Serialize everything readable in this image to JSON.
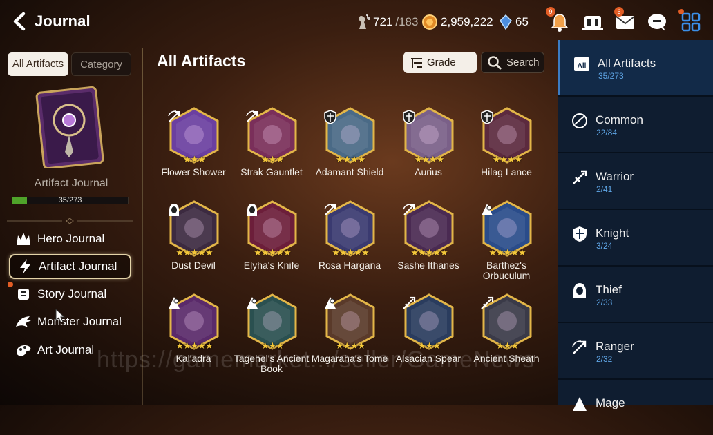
{
  "header": {
    "title": "Journal",
    "stamina": "721",
    "stamina_max": "/183",
    "gold": "2,959,222",
    "crystals": "65",
    "alerts_badge": "9",
    "mail_badge": "6"
  },
  "left": {
    "tabs": [
      "All Artifacts",
      "Category"
    ],
    "book_label": "Artifact Journal",
    "progress_text": "35/273",
    "progress_fraction": 0.128,
    "menu": [
      {
        "label": "Hero Journal",
        "icon": "hero-icon"
      },
      {
        "label": "Artifact Journal",
        "icon": "lightning-icon"
      },
      {
        "label": "Story Journal",
        "icon": "scroll-icon"
      },
      {
        "label": "Monster Journal",
        "icon": "dragon-icon"
      },
      {
        "label": "Art Journal",
        "icon": "palette-icon"
      }
    ]
  },
  "main": {
    "title": "All Artifacts",
    "grade_label": "Grade",
    "search_label": "Search",
    "artifacts": [
      {
        "name": "Flower Shower",
        "stars": "★★★",
        "cls": "ranger",
        "color": "#6b3fa0"
      },
      {
        "name": "Strak Gauntlet",
        "stars": "★★★",
        "cls": "ranger",
        "color": "#7a2f5a"
      },
      {
        "name": "Adamant Shield",
        "stars": "★★★★",
        "cls": "knight",
        "color": "#4a6a86"
      },
      {
        "name": "Aurius",
        "stars": "★★★★",
        "cls": "knight",
        "color": "#7a6088"
      },
      {
        "name": "Hilag Lance",
        "stars": "★★★★",
        "cls": "knight",
        "color": "#5c2a3e"
      },
      {
        "name": "Dust Devil",
        "stars": "★★★★★",
        "cls": "thief",
        "color": "#3c2a40"
      },
      {
        "name": "Elyha's Knife",
        "stars": "★★★★★",
        "cls": "thief",
        "color": "#6c1e3a"
      },
      {
        "name": "Rosa Hargana",
        "stars": "★★★★★",
        "cls": "ranger",
        "color": "#3a3a70"
      },
      {
        "name": "Sashe Ithanes",
        "stars": "★★★★★",
        "cls": "ranger",
        "color": "#4a2a52"
      },
      {
        "name": "Barthez's Orbuculum",
        "stars": "★★★★★",
        "cls": "mage",
        "color": "#2a4c8a"
      },
      {
        "name": "Kal'adra",
        "stars": "★★★★★",
        "cls": "mage",
        "color": "#5a2a6a"
      },
      {
        "name": "Tagehel's Ancient Book",
        "stars": "★★★",
        "cls": "mage",
        "color": "#2a5050"
      },
      {
        "name": "Magaraha's Tome",
        "stars": "★★★★",
        "cls": "mage",
        "color": "#5a3a2a"
      },
      {
        "name": "Alsacian Spear",
        "stars": "★★★",
        "cls": "warrior",
        "color": "#2a3c5e"
      },
      {
        "name": "Ancient Sheath",
        "stars": "★★★",
        "cls": "warrior",
        "color": "#3a3a48"
      }
    ]
  },
  "categories": [
    {
      "name": "All Artifacts",
      "count": "35/273",
      "icon": "all-icon"
    },
    {
      "name": "Common",
      "count": "22/84",
      "icon": "common-icon"
    },
    {
      "name": "Warrior",
      "count": "2/41",
      "icon": "warrior-icon"
    },
    {
      "name": "Knight",
      "count": "3/24",
      "icon": "knight-icon"
    },
    {
      "name": "Thief",
      "count": "2/33",
      "icon": "thief-icon"
    },
    {
      "name": "Ranger",
      "count": "2/32",
      "icon": "ranger-icon"
    },
    {
      "name": "Mage",
      "count": "",
      "icon": "mage-icon"
    }
  ],
  "watermark": "https://gamemarket.../seller/GameNews",
  "colors": {
    "accent_blue": "#3b7cc4",
    "badge_orange": "#e25d25",
    "progress_green": "#4fa32a",
    "gold_frame": "#e3b648"
  }
}
